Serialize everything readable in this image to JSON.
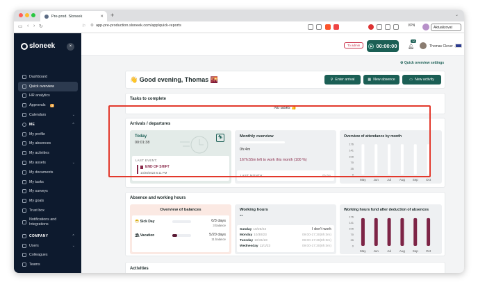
{
  "browser": {
    "tab_title": "Pre-prod. Sloneek",
    "url": "app-pre-production.sloneek.com/app/quick-reports",
    "vpn_label": "VPN",
    "update_label": "Aktualizovat"
  },
  "sidebar": {
    "logo": "sloneek",
    "items": [
      {
        "label": "Dashboard",
        "icon": "dashboard-icon"
      },
      {
        "label": "Quick overview",
        "icon": "grid-icon",
        "active": true
      },
      {
        "label": "HR analytics",
        "icon": "analytics-icon"
      },
      {
        "label": "Approvals",
        "icon": "approvals-icon",
        "badge": "3"
      },
      {
        "label": "Calendars",
        "icon": "calendar-icon",
        "chevron": true
      }
    ],
    "me_section": "ME",
    "me_items": [
      {
        "label": "My profile"
      },
      {
        "label": "My absences"
      },
      {
        "label": "My activities"
      },
      {
        "label": "My assets",
        "chevron": true
      },
      {
        "label": "My documents"
      },
      {
        "label": "My tasks"
      },
      {
        "label": "My surveys"
      },
      {
        "label": "My goals"
      },
      {
        "label": "Trust box"
      },
      {
        "label": "Notifications and Integrations"
      }
    ],
    "company_section": "COMPANY",
    "company_items": [
      {
        "label": "Users",
        "chevron": true
      },
      {
        "label": "Colleagues"
      },
      {
        "label": "Teams"
      }
    ]
  },
  "topbar": {
    "to_admin": "To admin",
    "timer": "00:00:00",
    "notifications": "10",
    "user_name": "Thomas Clever"
  },
  "main": {
    "quick_settings": "Quick overview settings",
    "greeting": "👋 Good evening, Thomas 🌇",
    "buttons": {
      "enter_arrival": "Enter arrival",
      "new_absence": "New absence",
      "new_activity": "New activity"
    },
    "tasks": {
      "title": "Tasks to complete",
      "empty": "No tasks 👍"
    },
    "arrivals": {
      "title": "Arrivals / departures",
      "today_label": "Today",
      "today_value": "00:01:38",
      "last_event_label": "LAST EVENT:",
      "last_event_name": "END OF SHIFT",
      "last_event_time": "10/28/2023 5:11 PM",
      "monthly_title": "Monthly overview",
      "monthly_hours": "0h:4m",
      "monthly_left": "167h:55m left to work this month (100 %)",
      "last_month_label": "LAST MONTH:",
      "last_month_value": "0h 0m",
      "attendance_title": "Overview of attendance by month"
    },
    "absence": {
      "title": "Absence and working hours",
      "balances_title": "Overview of balances",
      "sick_label": "Sick Day",
      "sick_value": "0/3 days",
      "sick_sub": "3 balance",
      "vacation_label": "Vacation",
      "vacation_value": "5/20 days",
      "vacation_sub": "11 balance",
      "vacation_progress": 0.25,
      "hours_title": "Working hours",
      "hours_dash": "--",
      "rows": [
        {
          "day": "Sunday",
          "date": "10/29/23",
          "value": "I don't work"
        },
        {
          "day": "Monday",
          "date": "10/30/23",
          "value": "09:00-17:30(8h:0m)"
        },
        {
          "day": "Tuesday",
          "date": "10/31/23",
          "value": "09:00-17:30(8h:0m)"
        },
        {
          "day": "Wednesday",
          "date": "11/1/23",
          "value": "09:00-17:30(8h:0m)"
        }
      ],
      "fund_title": "Working hours fund after deduction of absences"
    },
    "activities_title": "Activities"
  },
  "colors": {
    "brand": "#1b5f55",
    "accent": "#8a2a4a",
    "sidebar": "#0d1a2e",
    "highlight_border": "#e2382b"
  },
  "chart_data": [
    {
      "type": "bar",
      "title": "Overview of attendance by month",
      "categories": [
        "May",
        "Jun",
        "Jul",
        "Aug",
        "Sep",
        "Oct"
      ],
      "values": [
        175,
        175,
        175,
        175,
        175,
        175
      ],
      "yticks": [
        0,
        35,
        70,
        105,
        141,
        176
      ],
      "ylim": [
        0,
        176
      ]
    },
    {
      "type": "bar",
      "title": "Working hours fund after deduction of absences",
      "categories": [
        "May",
        "Jun",
        "Jul",
        "Aug",
        "Sep",
        "Oct"
      ],
      "values": [
        168,
        168,
        168,
        168,
        168,
        168
      ],
      "yticks": [
        0,
        35,
        70,
        105,
        141,
        176
      ],
      "ylim": [
        0,
        176
      ]
    }
  ]
}
